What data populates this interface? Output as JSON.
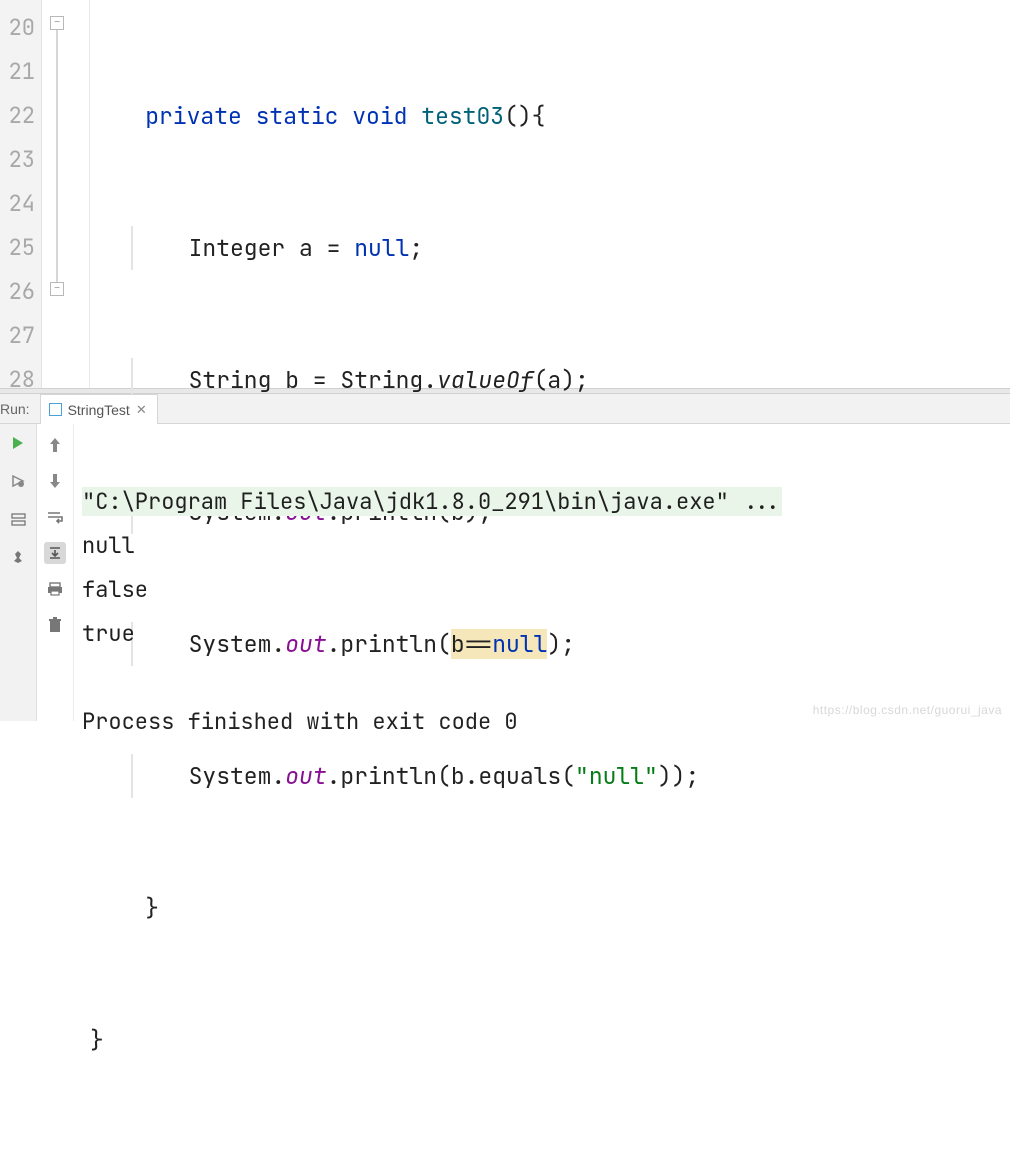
{
  "gutter": {
    "lines": [
      "20",
      "21",
      "22",
      "23",
      "24",
      "25",
      "26",
      "27",
      "28"
    ]
  },
  "code": {
    "l20": {
      "kw1": "private",
      "kw2": "static",
      "kw3": "void",
      "fn": "test03",
      "tail": "(){"
    },
    "l21": {
      "pre": "Integer a = ",
      "null": "null",
      "post": ";"
    },
    "l22": {
      "pre": "String b = String.",
      "m": "valueOf",
      "post": "(a);"
    },
    "l23": {
      "pre": "System.",
      "f": "out",
      "mid": ".println(b);",
      "tail": ""
    },
    "l24": {
      "pre": "System.",
      "f": "out",
      "mid": ".println(",
      "hl1": "b==",
      "hlnull": "null",
      "post": ");"
    },
    "l25": {
      "pre": "System.",
      "f": "out",
      "mid": ".println(b.equals(",
      "str": "\"null\"",
      "post": "));"
    },
    "l26": {
      "brace": "}"
    },
    "l27": {
      "brace": "}"
    }
  },
  "run": {
    "label": "Run:",
    "tab": "StringTest"
  },
  "console": {
    "cmd": "\"C:\\Program Files\\Java\\jdk1.8.0_291\\bin\\java.exe\" ...",
    "out1": "null",
    "out2": "false",
    "out3": "true",
    "blank": "",
    "exit": "Process finished with exit code 0"
  },
  "watermark": "https://blog.csdn.net/guorui_java"
}
